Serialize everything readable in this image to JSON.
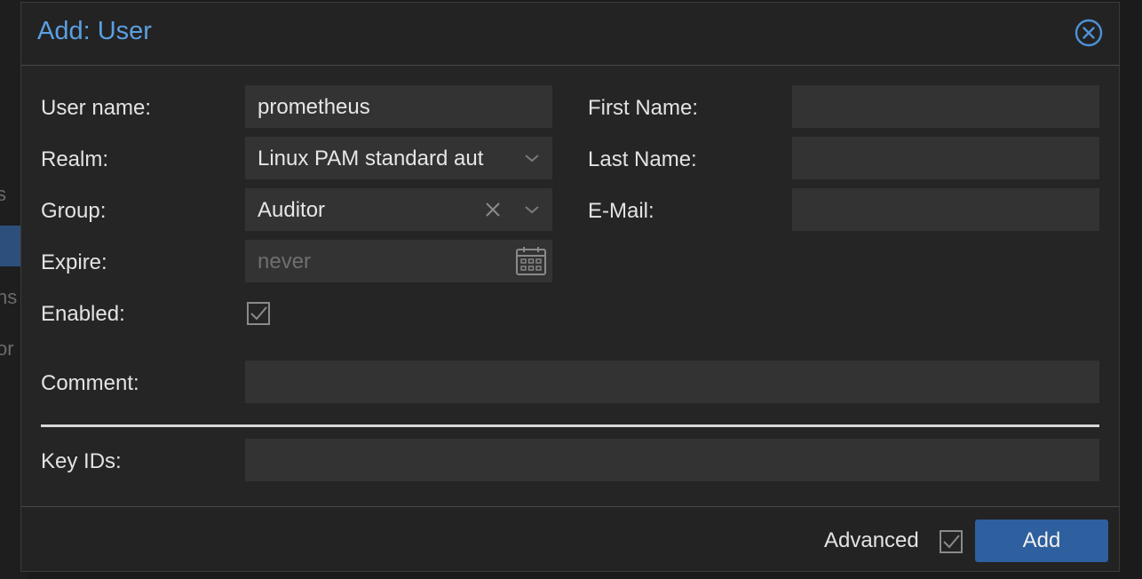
{
  "dialog": {
    "title": "Add: User",
    "close_icon": "close-circle-icon"
  },
  "form": {
    "username": {
      "label": "User name:",
      "value": "prometheus"
    },
    "realm": {
      "label": "Realm:",
      "value": "Linux PAM standard aut"
    },
    "group": {
      "label": "Group:",
      "value": "Auditor"
    },
    "expire": {
      "label": "Expire:",
      "placeholder": "never"
    },
    "enabled": {
      "label": "Enabled:",
      "checked": true
    },
    "first_name": {
      "label": "First Name:",
      "value": ""
    },
    "last_name": {
      "label": "Last Name:",
      "value": ""
    },
    "email": {
      "label": "E-Mail:",
      "value": ""
    },
    "comment": {
      "label": "Comment:",
      "value": ""
    },
    "key_ids": {
      "label": "Key IDs:",
      "value": ""
    }
  },
  "footer": {
    "advanced_label": "Advanced",
    "advanced_checked": true,
    "add_label": "Add"
  },
  "background": {
    "fragments": [
      "s",
      "ns",
      "or"
    ]
  },
  "colors": {
    "accent": "#5b9fe0",
    "button": "#2e5f9e",
    "field_bg": "#333333",
    "dialog_bg": "#232323"
  }
}
